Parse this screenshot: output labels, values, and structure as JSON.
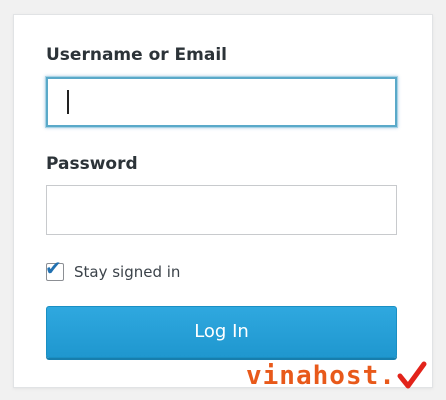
{
  "form": {
    "username_label": "Username or Email",
    "username_value": "",
    "password_label": "Password",
    "password_value": "",
    "remember_label": "Stay signed in",
    "remember_checked": true,
    "submit_label": "Log In"
  },
  "colors": {
    "accent": "#2271b1",
    "button": "#1f97cf",
    "focus_border": "#5aa9c9",
    "watermark": "#e8591a",
    "watermark_check": "#e2231a"
  },
  "watermark": {
    "text": "vinahost.",
    "icon": "checkmark-logo-icon"
  }
}
